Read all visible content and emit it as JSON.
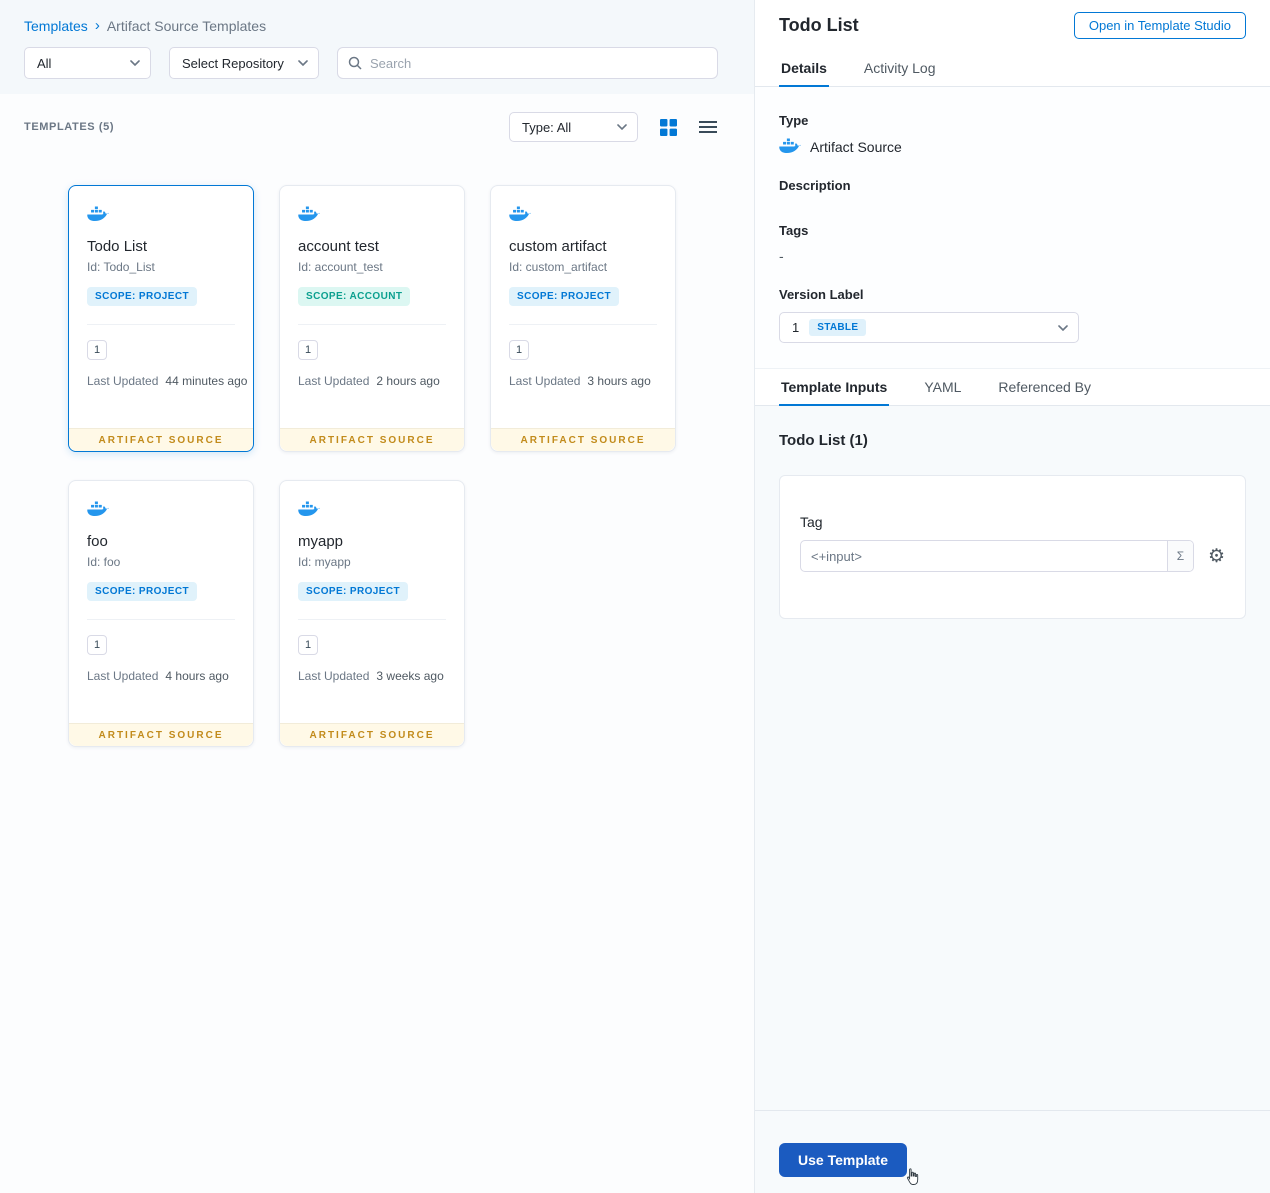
{
  "breadcrumb": {
    "templates_link": "Templates",
    "separator": "›",
    "current": "Artifact Source Templates"
  },
  "filters": {
    "scope": "All",
    "repository": "Select Repository",
    "search_placeholder": "Search"
  },
  "list": {
    "count": "TEMPLATES (5)",
    "type_filter": "Type: All",
    "cards": [
      {
        "title": "Todo List",
        "id": "Id: Todo_List",
        "scope": "SCOPE: PROJECT",
        "version": "1",
        "updated_label": "Last Updated",
        "updated_value": "44 minutes ago",
        "footer": "ARTIFACT SOURCE"
      },
      {
        "title": "account test",
        "id": "Id: account_test",
        "scope": "SCOPE: ACCOUNT",
        "version": "1",
        "updated_label": "Last Updated",
        "updated_value": "2 hours ago",
        "footer": "ARTIFACT SOURCE"
      },
      {
        "title": "custom artifact",
        "id": "Id: custom_artifact",
        "scope": "SCOPE: PROJECT",
        "version": "1",
        "updated_label": "Last Updated",
        "updated_value": "3 hours ago",
        "footer": "ARTIFACT SOURCE"
      },
      {
        "title": "foo",
        "id": "Id: foo",
        "scope": "SCOPE: PROJECT",
        "version": "1",
        "updated_label": "Last Updated",
        "updated_value": "4 hours ago",
        "footer": "ARTIFACT SOURCE"
      },
      {
        "title": "myapp",
        "id": "Id: myapp",
        "scope": "SCOPE: PROJECT",
        "version": "1",
        "updated_label": "Last Updated",
        "updated_value": "3 weeks ago",
        "footer": "ARTIFACT SOURCE"
      }
    ]
  },
  "panel": {
    "title": "Todo List",
    "open_studio_button": "Open in Template Studio",
    "tabs": {
      "details": "Details",
      "activity_log": "Activity Log"
    },
    "fields": {
      "type_label": "Type",
      "type_value": "Artifact Source",
      "description_label": "Description",
      "tags_label": "Tags",
      "tags_value": "-",
      "version_label": "Version Label",
      "version_value": "1",
      "version_badge": "STABLE"
    },
    "input_tabs": {
      "template_inputs": "Template Inputs",
      "yaml": "YAML",
      "referenced_by": "Referenced By"
    },
    "inputs": {
      "title": "Todo List (1)",
      "tag_label": "Tag",
      "tag_value": "<+input>",
      "expression_symbol": "Σ"
    },
    "use_template_button": "Use Template"
  },
  "colors": {
    "accent_blue": "#0278d5",
    "docker_blue": "#2496ed",
    "footer_gold": "#c28b1b",
    "footer_bg": "#fff9e7",
    "scope_project_bg": "#e0f2fb",
    "scope_account_text": "#0ba08f",
    "scope_account_bg": "#dcf7f2",
    "stable_bg": "#dff1fb",
    "use_template_blue": "#1b5bc0"
  }
}
